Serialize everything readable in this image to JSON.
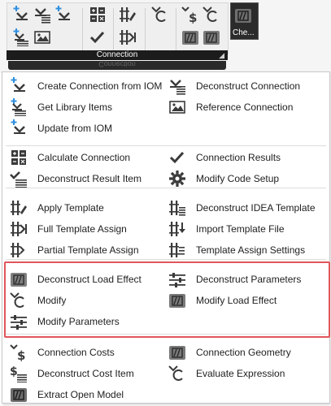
{
  "ribbon": {
    "group_label": "Connection",
    "group_label_reflection": "Connection",
    "extra_button_label": "Che...",
    "buttons": [
      {
        "icon": "create-connection-icon"
      },
      {
        "icon": "deconstruct-connection-icon"
      },
      {
        "icon": "update-from-iom-icon"
      },
      {
        "icon": "calculate-connection-icon"
      },
      {
        "icon": "apply-template-icon"
      },
      {
        "icon": "modify-icon"
      },
      {
        "icon": "connection-costs-icon"
      },
      {
        "icon": "evaluate-expression-icon"
      },
      {
        "icon": "extract-open-model-icon"
      },
      {
        "icon": "get-library-items-icon"
      },
      {
        "icon": "reference-connection-icon"
      },
      {
        "icon": "connection-results-icon"
      },
      {
        "icon": "template-assign-icon"
      },
      {
        "icon": "connection-geometry-icon"
      },
      {
        "icon": "modify-load-effect-icon"
      }
    ]
  },
  "menu": {
    "items": [
      {
        "label": "Create Connection from IOM",
        "icon": "create-connection-icon"
      },
      {
        "label": "Deconstruct Connection",
        "icon": "deconstruct-connection-icon"
      },
      {
        "label": "Get Library Items",
        "icon": "get-library-items-icon"
      },
      {
        "label": "Reference Connection",
        "icon": "reference-connection-icon"
      },
      {
        "label": "Update from IOM",
        "icon": "update-from-iom-icon"
      },
      {
        "label": "Calculate Connection",
        "icon": "calculate-connection-icon"
      },
      {
        "label": "Connection Results",
        "icon": "connection-results-icon"
      },
      {
        "label": "Deconstruct Result Item",
        "icon": "deconstruct-result-item-icon"
      },
      {
        "label": "Modify Code Setup",
        "icon": "gear-icon"
      },
      {
        "label": "Apply Template",
        "icon": "apply-template-icon"
      },
      {
        "label": "Deconstruct IDEA Template",
        "icon": "deconstruct-template-icon"
      },
      {
        "label": "Full Template Assign",
        "icon": "full-template-assign-icon"
      },
      {
        "label": "Import Template File",
        "icon": "import-template-file-icon"
      },
      {
        "label": "Partial Template Assign",
        "icon": "partial-template-assign-icon"
      },
      {
        "label": "Template Assign Settings",
        "icon": "template-assign-settings-icon"
      },
      {
        "label": "Deconstruct Load Effect",
        "icon": "deconstruct-load-effect-icon"
      },
      {
        "label": "Deconstruct Parameters",
        "icon": "deconstruct-parameters-icon"
      },
      {
        "label": "Modify",
        "icon": "modify-icon"
      },
      {
        "label": "Modify Load Effect",
        "icon": "modify-load-effect-icon"
      },
      {
        "label": "Modify Parameters",
        "icon": "modify-parameters-icon"
      },
      {
        "label": "Connection Costs",
        "icon": "connection-costs-icon"
      },
      {
        "label": "Connection Geometry",
        "icon": "connection-geometry-icon"
      },
      {
        "label": "Deconstruct Cost Item",
        "icon": "deconstruct-cost-item-icon"
      },
      {
        "label": "Evaluate Expression",
        "icon": "evaluate-expression-icon"
      },
      {
        "label": "Extract Open Model",
        "icon": "extract-open-model-icon"
      }
    ]
  },
  "colors": {
    "accent_blue": "#2f8fe0",
    "dark_icon": "#3a3a3a",
    "highlight_border": "#e0555a",
    "ribbon_bar": "#1c1c1c"
  }
}
